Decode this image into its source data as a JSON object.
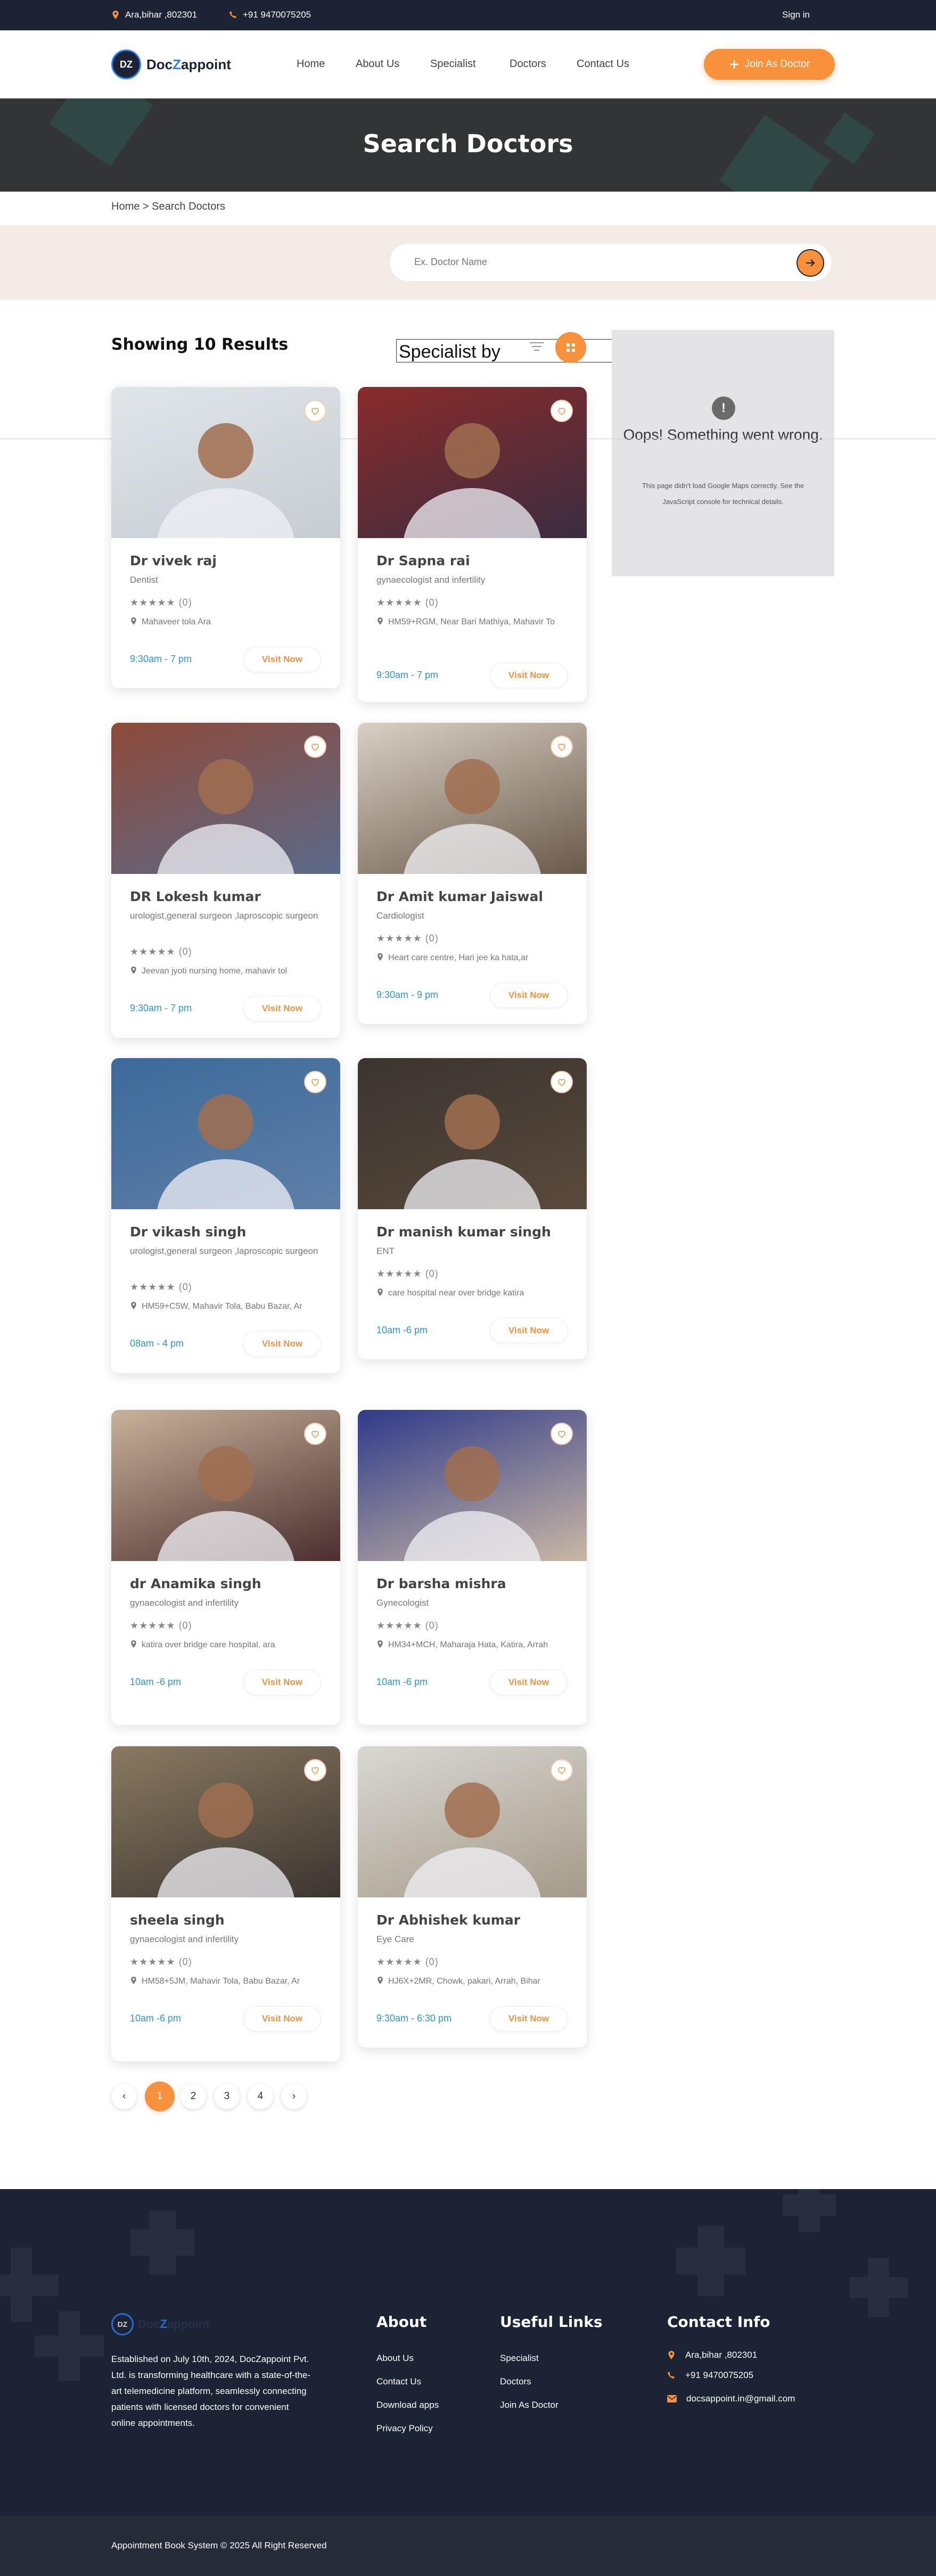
{
  "topbar": {
    "location": "Ara,bihar ,802301",
    "phone": "+91 9470075205",
    "signin": "Sign in"
  },
  "header": {
    "logo_mark": "DZ",
    "logo_pre": "Doc",
    "logo_z": "Z",
    "logo_post": "appoint",
    "nav": [
      "Home",
      "About Us",
      "Specialist",
      "Doctors",
      "Contact Us"
    ],
    "join_label": "Join As Doctor"
  },
  "banner": {
    "title": "Search Doctors"
  },
  "breadcrumb": "Home > Search Doctors",
  "search": {
    "placeholder": "Ex. Doctor Name"
  },
  "results": {
    "showing": "Showing 10 Results",
    "specialist_label": "Specialist by"
  },
  "map": {
    "title": "Oops! Something went wrong.",
    "message": "This page didn't load Google Maps correctly. See the JavaScript console for technical details."
  },
  "doctors": [
    {
      "name": "Dr vivek raj",
      "specialty": "Dentist",
      "rating": "(0)",
      "address": "Mahaveer tola Ara",
      "timing": "9:30am - 7 pm",
      "visit": "Visit Now"
    },
    {
      "name": "Dr Sapna rai",
      "specialty": "gynaecologist and infertility",
      "rating": "(0)",
      "address": "HM59+RGM, Near Bari Mathiya, Mahavir To",
      "timing": "9:30am - 7 pm",
      "visit": "Visit Now"
    },
    {
      "name": "DR Lokesh kumar",
      "specialty": "urologist,general surgeon ,laproscopic surgeon",
      "rating": "(0)",
      "address": "Jeevan jyoti nursing home, mahavir tol",
      "timing": "9:30am - 7 pm",
      "visit": "Visit Now"
    },
    {
      "name": "Dr Amit kumar Jaiswal",
      "specialty": "Cardiologist",
      "rating": "(0)",
      "address": "Heart care centre, Hari jee ka hata,ar",
      "timing": "9:30am - 9 pm",
      "visit": "Visit Now"
    },
    {
      "name": "Dr vikash singh",
      "specialty": "urologist,general surgeon ,laproscopic surgeon",
      "rating": "(0)",
      "address": "HM59+C5W, Mahavir Tola, Babu Bazar, Ar",
      "timing": "08am - 4 pm",
      "visit": "Visit Now"
    },
    {
      "name": "Dr manish kumar singh",
      "specialty": "ENT",
      "rating": "(0)",
      "address": "care hospital near over bridge katira",
      "timing": "10am -6 pm",
      "visit": "Visit Now"
    },
    {
      "name": "dr Anamika singh",
      "specialty": "gynaecologist and infertility",
      "rating": "(0)",
      "address": "katira over bridge care hospital, ara",
      "timing": "10am -6 pm",
      "visit": "Visit Now"
    },
    {
      "name": "Dr barsha mishra",
      "specialty": "Gynecologist",
      "rating": "(0)",
      "address": "HM34+MCH, Maharaja Hata, Katira, Arrah",
      "timing": "10am -6 pm",
      "visit": "Visit Now"
    },
    {
      "name": "sheela singh",
      "specialty": "gynaecologist and infertility",
      "rating": "(0)",
      "address": "HM58+5JM, Mahavir Tola, Babu Bazar, Ar",
      "timing": "10am -6 pm",
      "visit": "Visit Now"
    },
    {
      "name": "Dr Abhishek kumar",
      "specialty": "Eye Care",
      "rating": "(0)",
      "address": "HJ6X+2MR, Chowk, pakari, Arrah, Bihar",
      "timing": "9:30am - 6:30 pm",
      "visit": "Visit Now"
    }
  ],
  "pagination": {
    "prev": "‹",
    "pages": [
      "1",
      "2",
      "3",
      "4"
    ],
    "next": "›"
  },
  "footer": {
    "about_text": "Established on July 10th, 2024, DocZappoint Pvt. Ltd. is transforming healthcare with a state-of-the-art telemedicine platform, seamlessly connecting patients with licensed doctors for convenient online appointments.",
    "about_heading": "About",
    "about_links": [
      "About Us",
      "Contact Us",
      "Download apps",
      "Privacy Policy"
    ],
    "useful_heading": "Useful Links",
    "useful_links": [
      "Specialist",
      "Doctors",
      "Join As Doctor"
    ],
    "contact_heading": "Contact Info",
    "contact_address": "Ara,bihar ,802301",
    "contact_phone": "+91 9470075205",
    "contact_email": "docsappoint.in@gmail.com",
    "copyright": "Appointment Book System © 2025 All Right Reserved"
  },
  "colors": {
    "accent": "#f7913b",
    "navy": "#1c2334",
    "link_blue": "#2b98d6"
  }
}
